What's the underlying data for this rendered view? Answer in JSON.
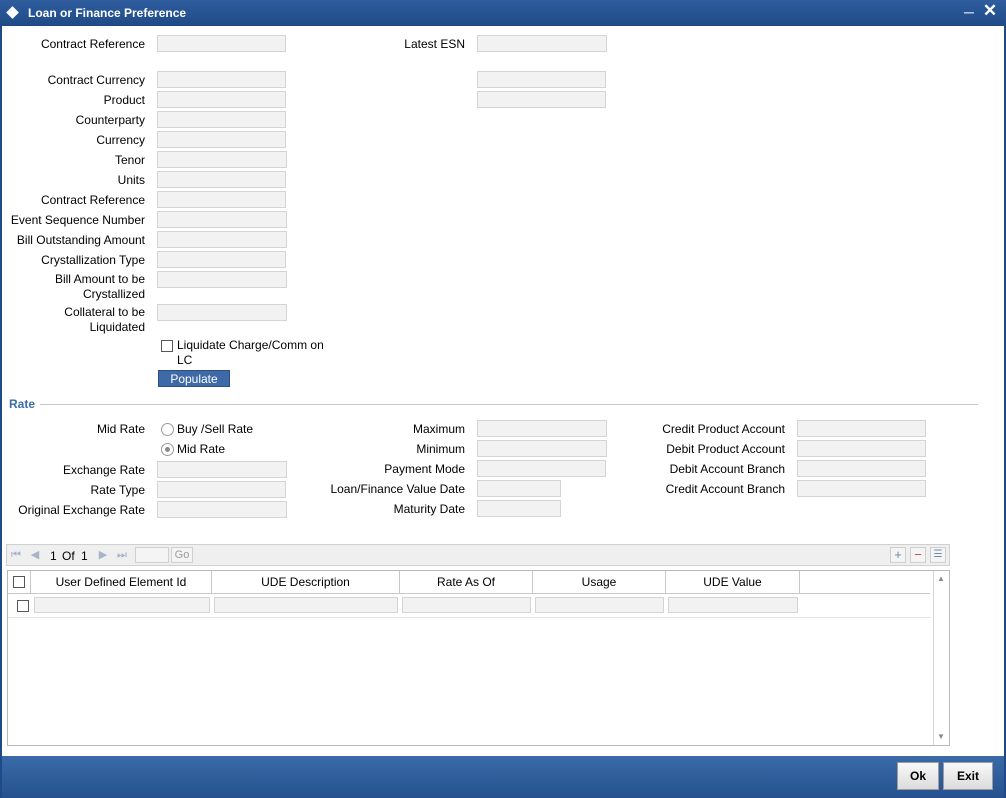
{
  "window": {
    "title": "Loan or Finance Preference"
  },
  "header_fields": {
    "contract_reference": "Contract Reference",
    "latest_esn": "Latest ESN"
  },
  "form": {
    "contract_currency": "Contract Currency",
    "product": "Product",
    "counterparty": "Counterparty",
    "currency": "Currency",
    "tenor": "Tenor",
    "units": "Units",
    "contract_reference": "Contract Reference",
    "event_sequence_number": "Event Sequence Number",
    "bill_outstanding_amount": "Bill Outstanding Amount",
    "crystallization_type": "Crystallization Type",
    "bill_amount_to_be_crystallized": "Bill Amount to be Crystallized",
    "collateral_to_be_liquidated": "Collateral to be Liquidated",
    "liquidate_charge_label": "Liquidate Charge/Comm on LC",
    "populate_button": "Populate"
  },
  "rate": {
    "section_title": "Rate",
    "mid_rate_label": "Mid Rate",
    "radio_buy_sell": "Buy /Sell Rate",
    "radio_mid_rate": "Mid Rate",
    "exchange_rate": "Exchange Rate",
    "rate_type": "Rate Type",
    "original_exchange_rate": "Original Exchange Rate",
    "maximum": "Maximum",
    "minimum": "Minimum",
    "payment_mode": "Payment Mode",
    "loan_finance_value_date": "Loan/Finance Value Date",
    "maturity_date": "Maturity Date",
    "credit_product_account": "Credit Product Account",
    "debit_product_account": "Debit Product Account",
    "debit_account_branch": "Debit Account Branch",
    "credit_account_branch": "Credit Account Branch"
  },
  "grid": {
    "page_current": "1",
    "page_of": "Of",
    "page_total": "1",
    "go_label": "Go",
    "columns": [
      "User Defined Element Id",
      "UDE Description",
      "Rate As Of",
      "Usage",
      "UDE Value"
    ]
  },
  "footer": {
    "ok": "Ok",
    "exit": "Exit"
  },
  "colors": {
    "title_bar": "#1f4a86",
    "accent": "#3f6aa8",
    "section_title": "#3a6ea5"
  }
}
